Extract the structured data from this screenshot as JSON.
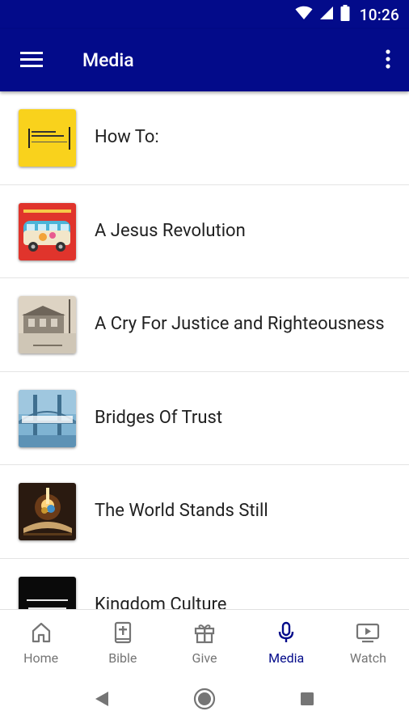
{
  "status_bar": {
    "time": "10:26"
  },
  "app_bar": {
    "title": "Media"
  },
  "media_items": [
    {
      "title": "How To:",
      "thumb": "yellow-cover"
    },
    {
      "title": "A Jesus Revolution",
      "thumb": "bus-cover"
    },
    {
      "title": "A Cry For Justice and Righteousness",
      "thumb": "building-cover"
    },
    {
      "title": "Bridges Of Trust",
      "thumb": "bridge-cover"
    },
    {
      "title": "The World Stands Still",
      "thumb": "book-cover"
    },
    {
      "title": "Kingdom Culture",
      "thumb": "kingdom-cover"
    }
  ],
  "bottom_nav": {
    "items": [
      {
        "label": "Home",
        "icon": "home-icon"
      },
      {
        "label": "Bible",
        "icon": "bible-icon"
      },
      {
        "label": "Give",
        "icon": "gift-icon"
      },
      {
        "label": "Media",
        "icon": "microphone-icon",
        "active": true
      },
      {
        "label": "Watch",
        "icon": "tv-play-icon"
      }
    ]
  },
  "colors": {
    "primary": "#030b8a",
    "text": "#212121",
    "inactive": "#757575"
  }
}
